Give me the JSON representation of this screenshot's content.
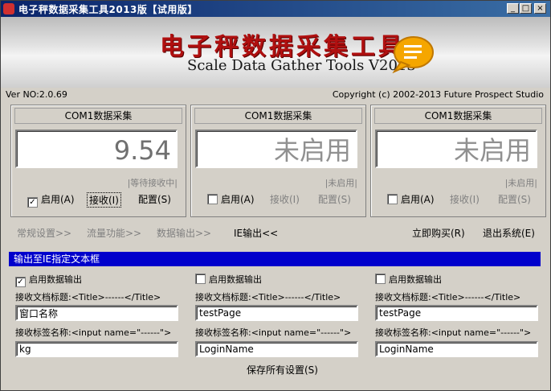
{
  "window": {
    "title": "电子秤数据采集工具2013版【试用版】",
    "minimize": "_",
    "maximize": "□",
    "close": "×"
  },
  "banner": {
    "title": "电子秤数据采集工具",
    "subtitle": "Scale Data Gather Tools V2013"
  },
  "version": "Ver NO:2.0.69",
  "copyright": "Copyright (c) 2002-2013 Future Prospect Studio",
  "panels": [
    {
      "header": "COM1数据采集",
      "display": "9.54",
      "status": "|等待接收中|",
      "enable_checked": "✓",
      "enable": "启用(A)",
      "receive": "接收(I)",
      "config": "配置(S)"
    },
    {
      "header": "COM1数据采集",
      "display": "未启用",
      "status": "|未启用|",
      "enable_checked": "",
      "enable": "启用(A)",
      "receive": "接收(I)",
      "config": "配置(S)"
    },
    {
      "header": "COM1数据采集",
      "display": "未启用",
      "status": "|未启用|",
      "enable_checked": "",
      "enable": "启用(A)",
      "receive": "接收(I)",
      "config": "配置(S)"
    }
  ],
  "nav": {
    "general": "常规设置>>",
    "flow": "流量功能>>",
    "data_output": "数据输出>>",
    "ie_output": "IE输出<<",
    "buy": "立即购买(R)",
    "exit": "退出系统(E)"
  },
  "section_title": "输出至IE指定文本框",
  "columns": [
    {
      "enable_checked": "✓",
      "enable_label": "启用数据输出",
      "title_label": "接收文档标题:<Title>------</Title>",
      "title_value": "窗口名称",
      "tag_label": "接收标签名称:<input name=\"------\">",
      "tag_value": "kg"
    },
    {
      "enable_checked": "",
      "enable_label": "启用数据输出",
      "title_label": "接收文档标题:<Title>------</Title>",
      "title_value": "testPage",
      "tag_label": "接收标签名称:<input name=\"------\">",
      "tag_value": "LoginName"
    },
    {
      "enable_checked": "",
      "enable_label": "启用数据输出",
      "title_label": "接收文档标题:<Title>------</Title>",
      "title_value": "testPage",
      "tag_label": "接收标签名称:<input name=\"------\">",
      "tag_value": "LoginName"
    }
  ],
  "save_label": "保存所有设置(S)",
  "colors": {
    "title_gradient_start": "#0a246a",
    "section_bar": "#0000cc",
    "logo_red": "#b01010"
  }
}
